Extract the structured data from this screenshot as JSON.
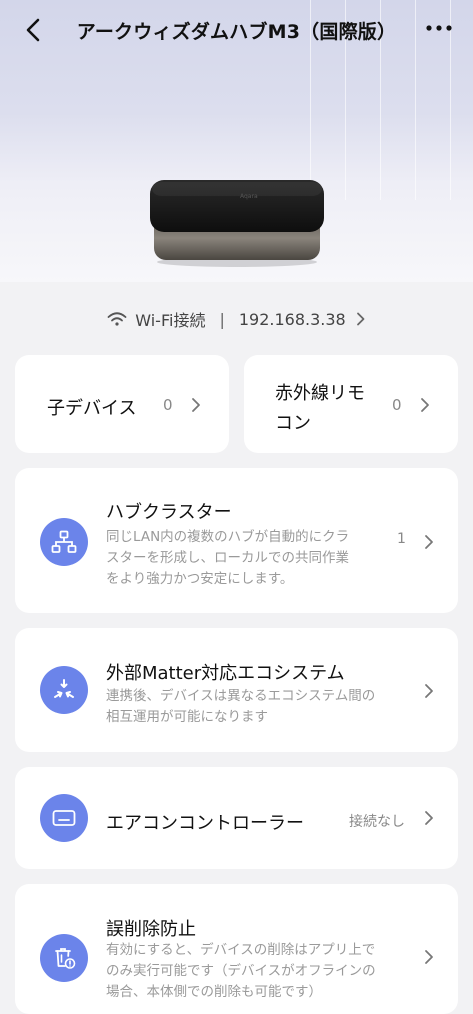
{
  "header": {
    "title": "アークウィズダムハブM3（国際版）"
  },
  "connection": {
    "type": "Wi-Fi接続",
    "ip": "192.168.3.38"
  },
  "tiles": [
    {
      "label": "子デバイス",
      "count": "0"
    },
    {
      "label_line1": "赤外線リモ",
      "label_line2": "コン",
      "count": "0"
    }
  ],
  "rows": {
    "cluster": {
      "title": "ハブクラスター",
      "desc_lines": [
        "同じLAN内の複数のハブが自動的にクラ",
        "スターを形成し、ローカルでの共同作業",
        "をより強力かつ安定にします。"
      ],
      "count": "1"
    },
    "matter": {
      "title": "外部Matter対応エコシステム",
      "desc_lines": [
        "連携後、デバイスは異なるエコシステム間の",
        "相互運用が可能になります"
      ]
    },
    "aircon": {
      "title": "エアコンコントローラー",
      "status": "接続なし"
    },
    "protect": {
      "title": "誤削除防止",
      "desc_lines": [
        "有効にすると、デバイスの削除はアプリ上で",
        "のみ実行可能です（デバイスがオフラインの",
        "場合、本体側での削除も可能です）"
      ]
    }
  },
  "colors": {
    "accent": "#6b84ea",
    "background": "#f2f2f4"
  },
  "icons": {
    "back": "chevron-left-icon",
    "more": "more-icon",
    "wifi": "wifi-icon",
    "cluster": "cluster-icon",
    "matter": "matter-icon",
    "aircon": "aircon-icon",
    "protect": "trash-lock-icon"
  }
}
